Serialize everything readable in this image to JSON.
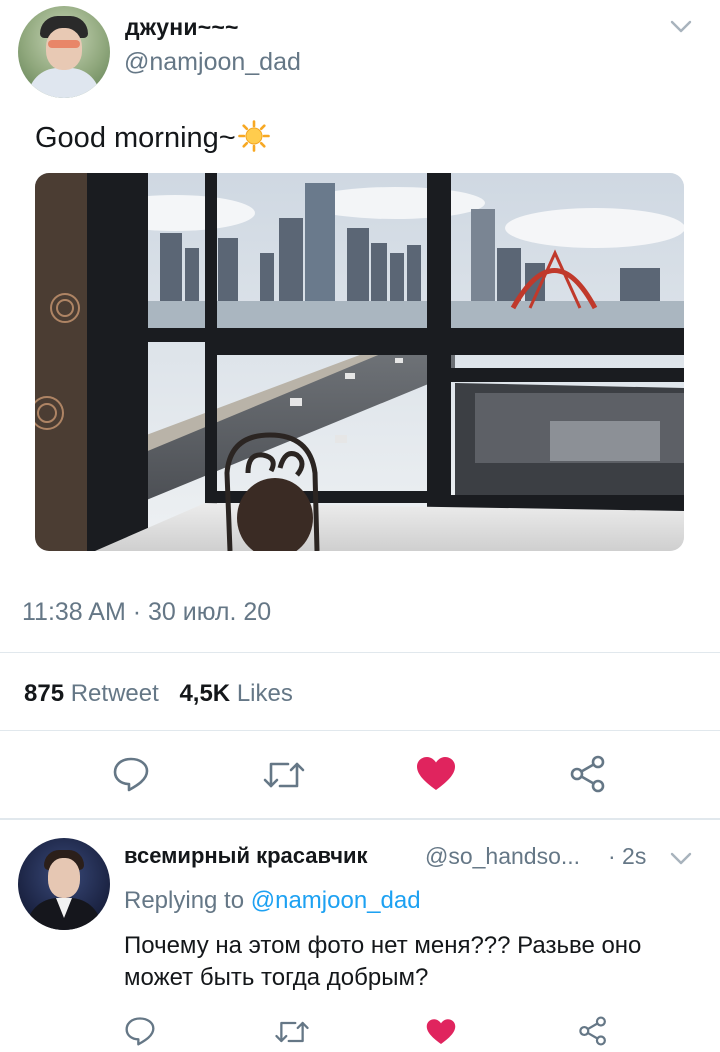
{
  "tweet": {
    "author": {
      "display_name": "джуни~~~",
      "handle": "@namjoon_dad"
    },
    "text": "Good morning~",
    "emoji": "sun-icon",
    "timestamp": "11:38 AM · 30 июл. 20",
    "stats": {
      "retweets_count": "875",
      "retweets_label": "Retweet",
      "likes_count": "4,5K",
      "likes_label": "Likes"
    },
    "actions": [
      "reply-icon",
      "retweet-icon",
      "like-icon",
      "share-icon"
    ],
    "liked": true
  },
  "reply": {
    "author": {
      "display_name": "всемирный красавчик",
      "handle": "@so_handso...",
      "time": "· 2s"
    },
    "replying_prefix": "Replying to",
    "replying_to": "@namjoon_dad",
    "text": "Почему на этом фото нет меня??? Разьве оно может быть тогда добрым?",
    "actions": [
      "reply-icon",
      "retweet-icon",
      "like-icon",
      "share-icon"
    ],
    "liked": true
  },
  "colors": {
    "text": "#14171a",
    "secondary": "#657786",
    "accent": "#1da1f2",
    "like": "#e0245e",
    "divider": "#e1e8ed"
  }
}
